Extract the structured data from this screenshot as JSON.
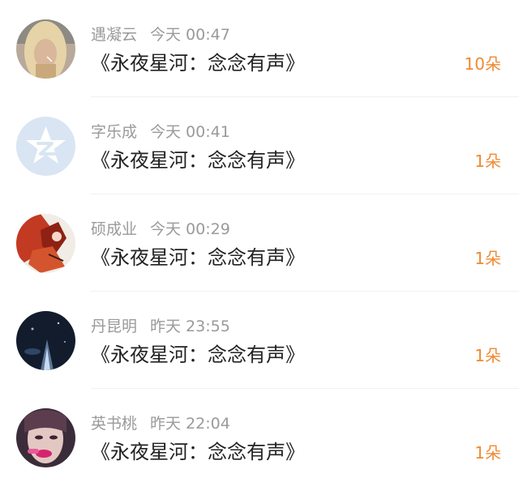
{
  "accent_color": "#ee8a33",
  "items": [
    {
      "name": "遇凝云",
      "time": "今天 00:47",
      "title": "《永夜星河：念念有声》",
      "count": "10朵",
      "avatar": "blonde-woman-photo"
    },
    {
      "name": "字乐成",
      "time": "今天 00:41",
      "title": "《永夜星河：念念有声》",
      "count": "1朵",
      "avatar": "default-star-avatar"
    },
    {
      "name": "硕成业",
      "time": "今天 00:29",
      "title": "《永夜星河：念念有声》",
      "count": "1朵",
      "avatar": "red-art-photo"
    },
    {
      "name": "丹昆明",
      "time": "昨天 23:55",
      "title": "《永夜星河：念念有声》",
      "count": "1朵",
      "avatar": "dark-night-photo"
    },
    {
      "name": "英书桃",
      "time": "昨天 22:04",
      "title": "《永夜星河：念念有声》",
      "count": "1朵",
      "avatar": "woman-pink-lips-photo"
    }
  ]
}
